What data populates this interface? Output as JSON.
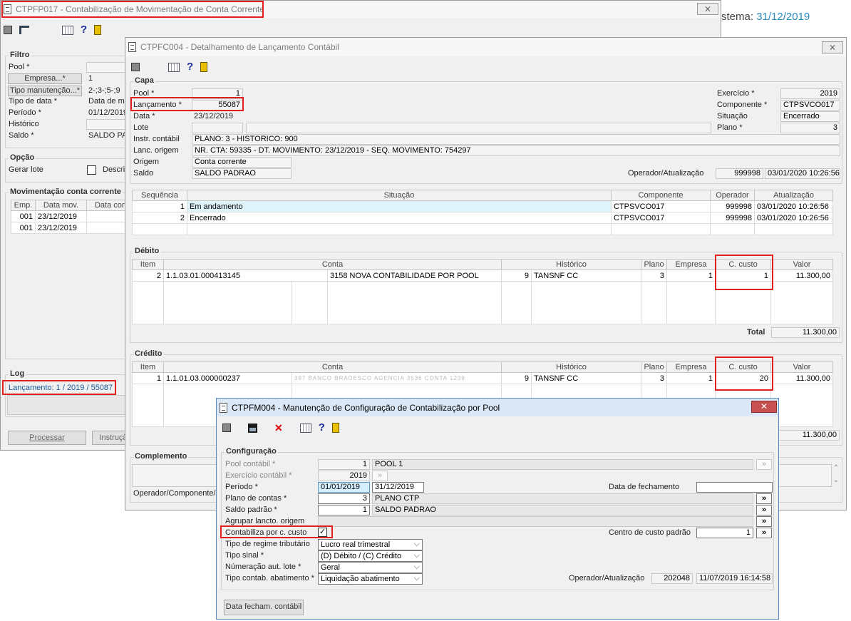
{
  "bg": {
    "date_prefix": "stema: ",
    "date": "31/12/2019"
  },
  "w1": {
    "title": "CTPFP017 - Contabilização de Movimentação de Conta Corrente",
    "close": "⨯",
    "filtro": "Filtro",
    "pool": "Pool *",
    "empresa": "Empresa...*",
    "empresa_val": "1",
    "tipo_man": "Tipo manutenção...*",
    "tipo_man_val": "2-;3-;5-;9",
    "tipo_data": "Tipo de data *",
    "tipo_data_val": "Data de mo",
    "periodo": "Período *",
    "periodo_val": "01/12/2019",
    "historico": "Histórico",
    "saldo": "Saldo *",
    "saldo_val": "SALDO PA",
    "opcao": "Opção",
    "gerar_lote": "Gerar lote",
    "descr": "Descri",
    "mov": "Movimentação conta corrente",
    "mov_cols": [
      "Emp.",
      "Data mov.",
      "Data cont"
    ],
    "mov_rows": [
      [
        "001",
        "23/12/2019",
        ""
      ],
      [
        "001",
        "23/12/2019",
        ""
      ]
    ],
    "log": "Log",
    "log_val": "Lançamento: 1 / 2019 / 55087",
    "processar": "Processar",
    "instrucao": "Instruçã"
  },
  "w2": {
    "title": "CTPFC004 - Detalhamento de Lançamento Contábil",
    "close": "⨯",
    "capa": "Capa",
    "pool": "Pool *",
    "pool_val": "1",
    "lanc": "Lançamento *",
    "lanc_val": "55087",
    "data": "Data *",
    "data_val": "23/12/2019",
    "lote": "Lote",
    "instr": "Instr. contábil",
    "instr_val": "PLANO: 3 - HISTORICO: 900",
    "lanc_origem": "Lanc. origem",
    "lanc_origem_val": "NR. CTA: 59335 - DT. MOVIMENTO: 23/12/2019 - SEQ. MOVIMENTO: 754297",
    "origem": "Origem",
    "origem_val": "Conta corrente",
    "saldo": "Saldo",
    "saldo_val": "SALDO PADRAO",
    "exercicio": "Exercício *",
    "exercicio_val": "2019",
    "componente": "Componente *",
    "componente_val": "CTPSVCO017",
    "situacao": "Situação",
    "situacao_val": "Encerrado",
    "plano": "Plano *",
    "plano_val": "3",
    "oper_atual": "Operador/Atualização",
    "oper_val": "999998",
    "atual_val": "03/01/2020 10:26:56",
    "sit_cols": [
      "Sequência",
      "Situação",
      "Componente",
      "Operador",
      "Atualização"
    ],
    "sit_rows": [
      [
        "1",
        "Em andamento",
        "CTPSVCO017",
        "999998",
        "03/01/2020 10:26:56"
      ],
      [
        "2",
        "Encerrado",
        "CTPSVCO017",
        "999998",
        "03/01/2020 10:26:56"
      ]
    ],
    "debito": "Débito",
    "cols": [
      "Item",
      "Conta",
      "Histórico",
      "Plano",
      "Empresa",
      "C. custo",
      "Valor"
    ],
    "deb_row": [
      "2",
      "1.1.03.01.000413145",
      "3158",
      "NOVA CONTABILIDADE POR POOL",
      "9",
      "TANSNF CC",
      "3",
      "1",
      "1",
      "11.300,00"
    ],
    "total": "Total",
    "total_val": "11.300,00",
    "credito": "Crédito",
    "cred_row": [
      "1",
      "1.1.01.03.000000237",
      "9",
      "TANSNF CC",
      "3",
      "1",
      "20",
      "11.300,00"
    ],
    "cred_blur": "387 BANCO BRADESCO AGENCIA 3536 CONTA 1239",
    "cred_total": "11.300,00",
    "complemento": "Complemento",
    "oper_comp": "Operador/Componente/A"
  },
  "w3": {
    "title": "CTPFM004 - Manutenção de Configuração de Contabilização por Pool",
    "close": "✕",
    "config": "Configuração",
    "pool": "Pool contábil *",
    "pool_num": "1",
    "pool_name": "POOL 1",
    "exerc": "Exercício contábil *",
    "exerc_val": "2019",
    "periodo": "Período *",
    "per_ini": "01/01/2019",
    "per_fim": "31/12/2019",
    "data_fech": "Data de fechamento",
    "plano": "Plano de contas *",
    "plano_num": "3",
    "plano_name": "PLANO CTP",
    "saldo": "Saldo padrão *",
    "saldo_num": "1",
    "saldo_name": "SALDO PADRAO",
    "agrupar": "Agrupar lancto. origem",
    "contab_cc": "Contabiliza por c. custo",
    "cc_padrao": "Centro de custo padrão",
    "cc_val": "1",
    "regime": "Tipo de regime tributário",
    "regime_val": "Lucro real trimestral",
    "sinal": "Tipo sinal *",
    "sinal_val": "(D) Débito / (C) Crédito",
    "numer": "Númeração aut. lote *",
    "numer_val": "Geral",
    "abat": "Tipo contab. abatimento *",
    "abat_val": "Liquidação abatimento",
    "oper_atual": "Operador/Atualização",
    "oper_val": "202048",
    "atual_val": "11/07/2019 16:14:58",
    "data_fech_btn": "Data fecham. contábil"
  },
  "colors": {
    "accent": "#2a8bbd",
    "highlight": "#e02020"
  }
}
